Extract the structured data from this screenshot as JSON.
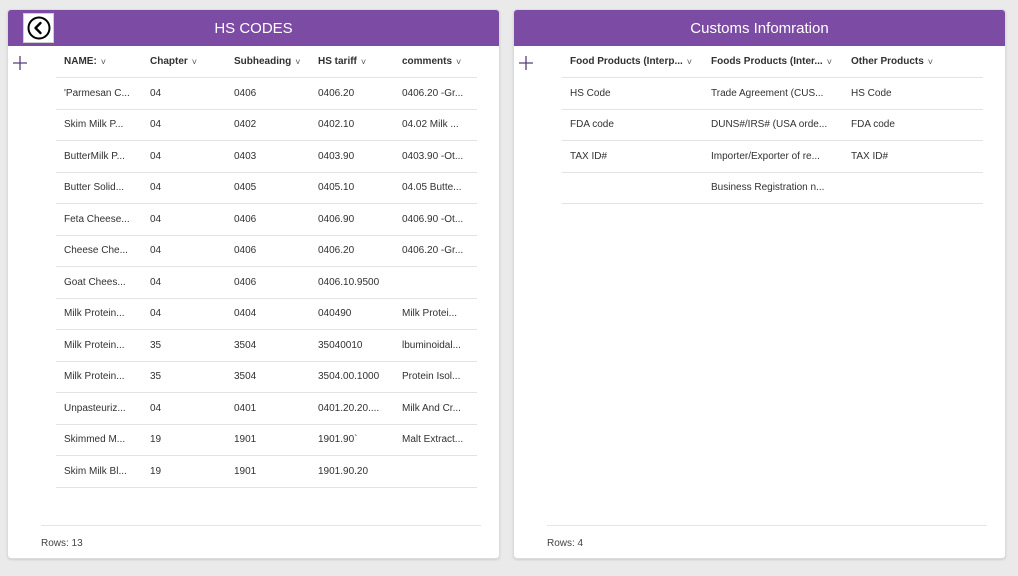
{
  "hs_panel": {
    "title": "HS CODES",
    "columns": [
      "NAME:",
      "Chapter",
      "Subheading",
      "HS tariff",
      "comments"
    ],
    "rows": [
      [
        "'Parmesan C...",
        "04",
        "0406",
        "0406.20",
        "0406.20 -Gr..."
      ],
      [
        "Skim Milk P...",
        "04",
        "0402",
        "0402.10",
        "04.02 Milk ..."
      ],
      [
        "ButterMilk P...",
        "04",
        "0403",
        "0403.90",
        "0403.90 -Ot..."
      ],
      [
        "Butter Solid...",
        "04",
        "0405",
        "0405.10",
        "04.05 Butte..."
      ],
      [
        "Feta Cheese...",
        "04",
        "0406",
        "0406.90",
        "0406.90 -Ot..."
      ],
      [
        "Cheese Che...",
        "04",
        "0406",
        "0406.20",
        "0406.20 -Gr..."
      ],
      [
        "Goat Chees...",
        "04",
        "0406",
        "0406.10.9500",
        ""
      ],
      [
        "Milk Protein...",
        "04",
        "0404",
        "040490",
        "Milk Protei..."
      ],
      [
        "Milk Protein...",
        "35",
        "3504",
        "35040010",
        "lbuminoidal..."
      ],
      [
        "Milk Protein...",
        "35",
        "3504",
        "3504.00.1000",
        "Protein Isol..."
      ],
      [
        "Unpasteuriz...",
        "04",
        "0401",
        "0401.20.20....",
        "Milk And Cr..."
      ],
      [
        "Skimmed M...",
        "19",
        "1901",
        "1901.90`",
        "Malt Extract..."
      ],
      [
        "Skim Milk Bl...",
        "19",
        "1901",
        "1901.90.20",
        ""
      ]
    ],
    "rows_label": "Rows: 13"
  },
  "customs_panel": {
    "title": "Customs Infomration",
    "columns": [
      "Food Products (Interp...",
      "Foods Products (Inter...",
      "Other Products"
    ],
    "rows": [
      [
        "HS Code",
        "Trade Agreement (CUS...",
        "HS Code"
      ],
      [
        "FDA code",
        "DUNS#/IRS# (USA orde...",
        "FDA code"
      ],
      [
        "TAX ID#",
        "Importer/Exporter of re...",
        "TAX ID#"
      ],
      [
        "",
        "Business Registration n...",
        ""
      ]
    ],
    "rows_label": "Rows: 4"
  },
  "colors": {
    "header_purple": "#7c4ba3",
    "background": "#eaeaea"
  },
  "icons": {
    "back": "circle-arrow-left-icon",
    "add": "plus-icon",
    "sort": "chevron-down-icon"
  }
}
